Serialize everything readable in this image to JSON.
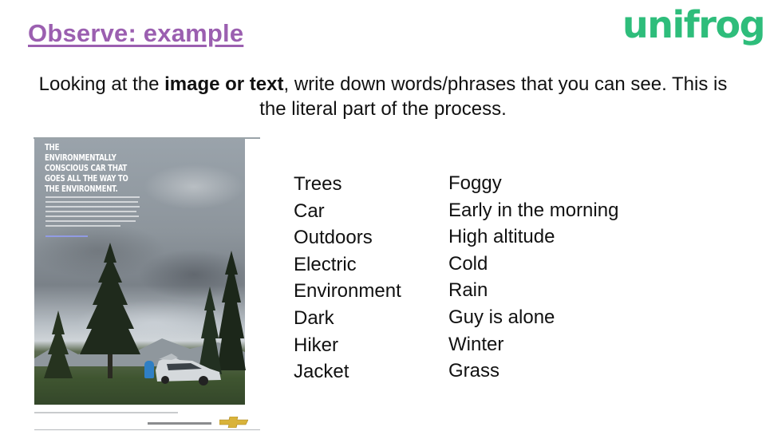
{
  "slide": {
    "title": "Observe: example",
    "logo_text": "unifrog",
    "colors": {
      "title": "#9b5fb0",
      "logo": "#2ebd7b"
    }
  },
  "instruction": {
    "part1": "Looking at the ",
    "bold": "image or text",
    "part2": ", write down words/phrases that you can see. This is the literal part of the process."
  },
  "advertisement": {
    "headline": "THE ENVIRONMENTALLY CONSCIOUS CAR THAT GOES ALL THE WAY TO THE ENVIRONMENT.",
    "brand_icon": "chevrolet-bowtie-icon"
  },
  "observations": {
    "column_1": [
      "Trees",
      "Car",
      "Outdoors",
      "Electric",
      "Environment",
      "Dark",
      "Hiker",
      "Jacket"
    ],
    "column_2": [
      "Foggy",
      "Early in the morning",
      "High altitude",
      "Cold",
      "Rain",
      "Guy is alone",
      "Winter",
      "Grass"
    ]
  }
}
